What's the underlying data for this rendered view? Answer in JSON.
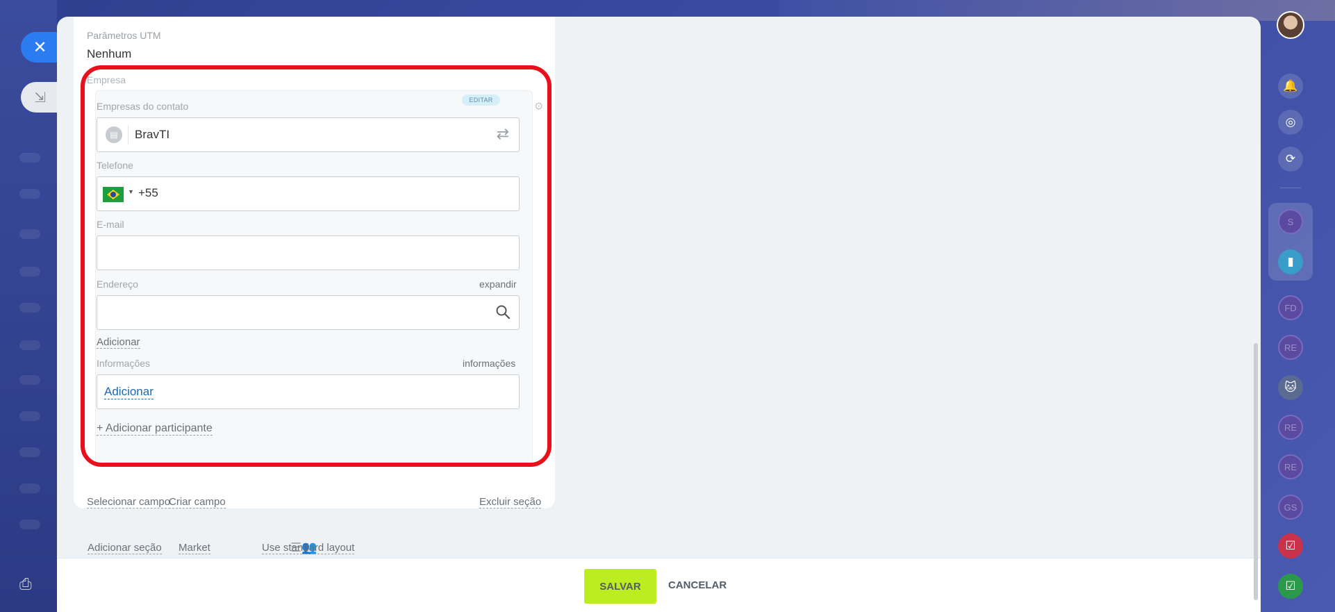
{
  "background": {
    "accent": "#2a7cf0"
  },
  "card": {
    "utm_label": "Parâmetros UTM",
    "utm_value": "Nenhum",
    "section_label": "Empresa",
    "companies_label": "Empresas do contato",
    "editar_badge": "EDITAR",
    "company_name": "BravTI",
    "phone_label": "Telefone",
    "phone_code": "+55",
    "email_label": "E-mail",
    "email_value": "",
    "address_label": "Endereço",
    "address_expand": "expandir",
    "add_link": "Adicionar",
    "info_label": "Informações",
    "info_right": "informações",
    "info_add": "Adicionar",
    "add_participant": "+ Adicionar participante",
    "select_field": "Selecionar campo",
    "create_field": "Criar campo",
    "delete_section": "Excluir seção"
  },
  "bottom_links": {
    "add_section": "Adicionar seção",
    "market": "Market",
    "standard_layout": "Use standard layout"
  },
  "actions": {
    "save": "SALVAR",
    "cancel": "CANCELAR",
    "save_color": "#bbed21"
  },
  "rail": {
    "avatars": [
      "S",
      "FD",
      "RE",
      "RE",
      "RE",
      "GS"
    ]
  }
}
